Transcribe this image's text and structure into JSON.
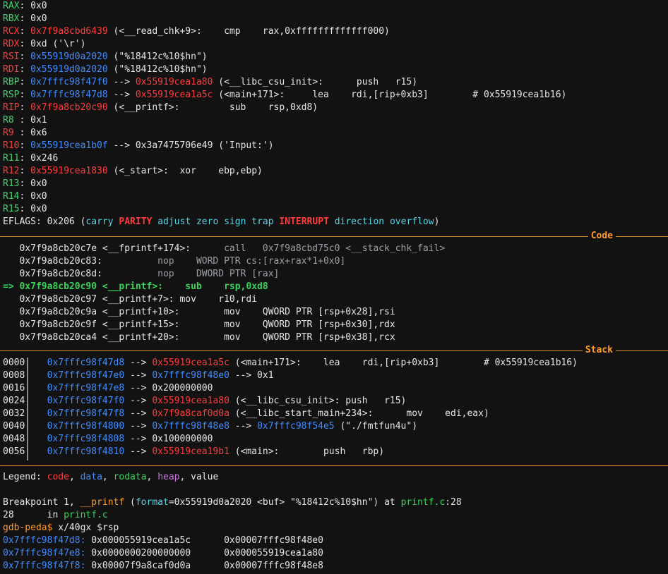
{
  "registers": [
    {
      "name": "RAX",
      "value": "0x0"
    },
    {
      "name": "RBX",
      "value": "0x0"
    },
    {
      "name": "RCX",
      "addr": "0x7f9a8cbd6439",
      "rest": " (<__read_chk+9>:    cmp    rax,0xfffffffffffff000)"
    },
    {
      "name": "RDX",
      "value": "0xd ('\\r')"
    },
    {
      "name": "RSI",
      "addr": "0x55919d0a2020",
      "rest": " (\"%18412c%10$hn\")"
    },
    {
      "name": "RDI",
      "addr": "0x55919d0a2020",
      "rest": " (\"%18412c%10$hn\")"
    },
    {
      "name": "RBP",
      "addr": "0x7fffc98f47f0",
      "arrow": " --> ",
      "addr2": "0x55919cea1a80",
      "rest": " (<__libc_csu_init>:      push   r15)"
    },
    {
      "name": "RSP",
      "addr": "0x7fffc98f47d8",
      "arrow": " --> ",
      "addr2": "0x55919cea1a5c",
      "rest": " (<main+171>:     lea    rdi,[rip+0xb3]        # 0x55919cea1b16)"
    },
    {
      "name": "RIP",
      "addr": "0x7f9a8cb20c90",
      "rest": " (<__printf>:         sub    rsp,0xd8)"
    },
    {
      "name": "R8 ",
      "value": "0x1"
    },
    {
      "name": "R9 ",
      "value": "0x6"
    },
    {
      "name": "R10",
      "addr": "0x55919cea1b0f",
      "arrow": " --> ",
      "rest": "0x3a7475706e49 ('Input:')"
    },
    {
      "name": "R11",
      "value": "0x246"
    },
    {
      "name": "R12",
      "addr": "0x55919cea1830",
      "rest": " (<_start>:  xor    ebp,ebp)"
    },
    {
      "name": "R13",
      "value": "0x0"
    },
    {
      "name": "R14",
      "value": "0x0"
    },
    {
      "name": "R15",
      "value": "0x0"
    }
  ],
  "eflags": {
    "label": "EFLAGS",
    "value": "0x206",
    "open": " (",
    "flags": [
      {
        "text": "carry",
        "set": false
      },
      {
        "text": "PARITY",
        "set": true
      },
      {
        "text": "adjust",
        "set": false
      },
      {
        "text": "zero",
        "set": false
      },
      {
        "text": "sign",
        "set": false
      },
      {
        "text": "trap",
        "set": false
      },
      {
        "text": "INTERRUPT",
        "set": true
      },
      {
        "text": "direction",
        "set": false
      },
      {
        "text": "overflow",
        "set": false
      }
    ],
    "close": ")"
  },
  "code_section_label": "Code",
  "code": [
    {
      "prefix": "   ",
      "addr": "0x7f9a8cb20c7e",
      "sym": " <__fprintf+174>:",
      "op": "      call   0x7f9a8cbd75c0 <__stack_chk_fail>",
      "current": false
    },
    {
      "prefix": "   ",
      "addr": "0x7f9a8cb20c83",
      "sym": ":",
      "op": "          nop    WORD PTR cs:[rax+rax*1+0x0]",
      "current": false
    },
    {
      "prefix": "   ",
      "addr": "0x7f9a8cb20c8d",
      "sym": ":",
      "op": "          nop    DWORD PTR [rax]",
      "current": false
    },
    {
      "prefix": "=> ",
      "addr": "0x7f9a8cb20c90",
      "sym": " <__printf>:",
      "op": "    sub    rsp,0xd8",
      "current": true
    },
    {
      "prefix": "   ",
      "addr": "0x7f9a8cb20c97",
      "sym": " <__printf+7>:",
      "op": " mov    r10,rdi",
      "current": false
    },
    {
      "prefix": "   ",
      "addr": "0x7f9a8cb20c9a",
      "sym": " <__printf+10>:",
      "op": "        mov    QWORD PTR [rsp+0x28],rsi",
      "current": false
    },
    {
      "prefix": "   ",
      "addr": "0x7f9a8cb20c9f",
      "sym": " <__printf+15>:",
      "op": "        mov    QWORD PTR [rsp+0x30],rdx",
      "current": false
    },
    {
      "prefix": "   ",
      "addr": "0x7f9a8cb20ca4",
      "sym": " <__printf+20>:",
      "op": "        mov    QWORD PTR [rsp+0x38],rcx",
      "current": false
    }
  ],
  "stack_section_label": "Stack",
  "stack": [
    {
      "off": "0000",
      "addr": "0x7fffc98f47d8",
      "arrow": " --> ",
      "t1": "0x55919cea1a5c",
      "t1class": "red",
      "rest": " (<main+171>:    lea    rdi,[rip+0xb3]        # 0x55919cea1b16)"
    },
    {
      "off": "0008",
      "addr": "0x7fffc98f47e0",
      "arrow": " --> ",
      "t1": "0x7fffc98f48e0",
      "t1class": "blue",
      "rest": " --> 0x1"
    },
    {
      "off": "0016",
      "addr": "0x7fffc98f47e8",
      "arrow": " --> ",
      "t1": "",
      "t1class": "",
      "rest": "0x200000000"
    },
    {
      "off": "0024",
      "addr": "0x7fffc98f47f0",
      "arrow": " --> ",
      "t1": "0x55919cea1a80",
      "t1class": "red",
      "rest": " (<__libc_csu_init>: push   r15)"
    },
    {
      "off": "0032",
      "addr": "0x7fffc98f47f8",
      "arrow": " --> ",
      "t1": "0x7f9a8caf0d0a",
      "t1class": "red",
      "rest": " (<__libc_start_main+234>:      mov    edi,eax)"
    },
    {
      "off": "0040",
      "addr": "0x7fffc98f4800",
      "arrow": " --> ",
      "t1": "0x7fffc98f48e8",
      "t1class": "blue",
      "rest2": " --> ",
      "t2": "0x7fffc98f54e5",
      "rest": " (\"./fmtfun4u\")"
    },
    {
      "off": "0048",
      "addr": "0x7fffc98f4808",
      "arrow": " --> ",
      "t1": "",
      "t1class": "",
      "rest": "0x100000000"
    },
    {
      "off": "0056",
      "addr": "0x7fffc98f4810",
      "arrow": " --> ",
      "t1": "0x55919cea19b1",
      "t1class": "red",
      "rest": " (<main>:        push   rbp)"
    }
  ],
  "legend": {
    "prefix": "Legend: ",
    "items": [
      {
        "text": "code",
        "cls": "red"
      },
      {
        "text": "data",
        "cls": "blue"
      },
      {
        "text": "rodata",
        "cls": "green"
      },
      {
        "text": "heap",
        "cls": "magenta"
      },
      {
        "text": "value",
        "cls": "white"
      }
    ]
  },
  "breakpoint": {
    "pre": "Breakpoint 1, ",
    "func": "__printf",
    "open": " (",
    "param": "format",
    "eq": "=0x55919d0a2020 <buf> \"%18412c%10$hn\") at ",
    "file": "printf.c",
    "line": ":28"
  },
  "source_line": {
    "num": "28",
    "gap": "\tin ",
    "file": "printf.c"
  },
  "prompt": {
    "text": "gdb-peda$",
    "cmd": " x/40gx $rsp"
  },
  "memdump": [
    {
      "addr": "0x7fffc98f47d8:",
      "v1": " 0x000055919cea1a5c",
      "v2": "      0x00007fffc98f48e0"
    },
    {
      "addr": "0x7fffc98f47e8:",
      "v1": " 0x0000000200000000",
      "v2": "      0x000055919cea1a80"
    },
    {
      "addr": "0x7fffc98f47f8:",
      "v1": " 0x00007f9a8caf0d0a",
      "v2": "      0x00007fffc98f48e8"
    }
  ],
  "colors": {
    "background": "#121212",
    "separator": "#d88a2c",
    "section_label": "#ff9d2b"
  }
}
